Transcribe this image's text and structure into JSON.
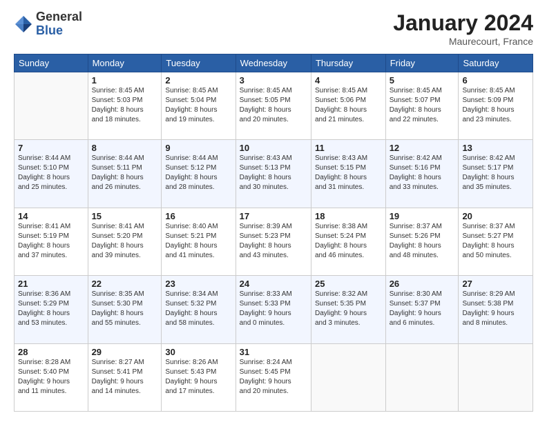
{
  "header": {
    "logo_general": "General",
    "logo_blue": "Blue",
    "month_title": "January 2024",
    "location": "Maurecourt, France"
  },
  "weekdays": [
    "Sunday",
    "Monday",
    "Tuesday",
    "Wednesday",
    "Thursday",
    "Friday",
    "Saturday"
  ],
  "weeks": [
    [
      {
        "day": "",
        "sunrise": "",
        "sunset": "",
        "daylight": ""
      },
      {
        "day": "1",
        "sunrise": "Sunrise: 8:45 AM",
        "sunset": "Sunset: 5:03 PM",
        "daylight": "Daylight: 8 hours and 18 minutes."
      },
      {
        "day": "2",
        "sunrise": "Sunrise: 8:45 AM",
        "sunset": "Sunset: 5:04 PM",
        "daylight": "Daylight: 8 hours and 19 minutes."
      },
      {
        "day": "3",
        "sunrise": "Sunrise: 8:45 AM",
        "sunset": "Sunset: 5:05 PM",
        "daylight": "Daylight: 8 hours and 20 minutes."
      },
      {
        "day": "4",
        "sunrise": "Sunrise: 8:45 AM",
        "sunset": "Sunset: 5:06 PM",
        "daylight": "Daylight: 8 hours and 21 minutes."
      },
      {
        "day": "5",
        "sunrise": "Sunrise: 8:45 AM",
        "sunset": "Sunset: 5:07 PM",
        "daylight": "Daylight: 8 hours and 22 minutes."
      },
      {
        "day": "6",
        "sunrise": "Sunrise: 8:45 AM",
        "sunset": "Sunset: 5:09 PM",
        "daylight": "Daylight: 8 hours and 23 minutes."
      }
    ],
    [
      {
        "day": "7",
        "sunrise": "Sunrise: 8:44 AM",
        "sunset": "Sunset: 5:10 PM",
        "daylight": "Daylight: 8 hours and 25 minutes."
      },
      {
        "day": "8",
        "sunrise": "Sunrise: 8:44 AM",
        "sunset": "Sunset: 5:11 PM",
        "daylight": "Daylight: 8 hours and 26 minutes."
      },
      {
        "day": "9",
        "sunrise": "Sunrise: 8:44 AM",
        "sunset": "Sunset: 5:12 PM",
        "daylight": "Daylight: 8 hours and 28 minutes."
      },
      {
        "day": "10",
        "sunrise": "Sunrise: 8:43 AM",
        "sunset": "Sunset: 5:13 PM",
        "daylight": "Daylight: 8 hours and 30 minutes."
      },
      {
        "day": "11",
        "sunrise": "Sunrise: 8:43 AM",
        "sunset": "Sunset: 5:15 PM",
        "daylight": "Daylight: 8 hours and 31 minutes."
      },
      {
        "day": "12",
        "sunrise": "Sunrise: 8:42 AM",
        "sunset": "Sunset: 5:16 PM",
        "daylight": "Daylight: 8 hours and 33 minutes."
      },
      {
        "day": "13",
        "sunrise": "Sunrise: 8:42 AM",
        "sunset": "Sunset: 5:17 PM",
        "daylight": "Daylight: 8 hours and 35 minutes."
      }
    ],
    [
      {
        "day": "14",
        "sunrise": "Sunrise: 8:41 AM",
        "sunset": "Sunset: 5:19 PM",
        "daylight": "Daylight: 8 hours and 37 minutes."
      },
      {
        "day": "15",
        "sunrise": "Sunrise: 8:41 AM",
        "sunset": "Sunset: 5:20 PM",
        "daylight": "Daylight: 8 hours and 39 minutes."
      },
      {
        "day": "16",
        "sunrise": "Sunrise: 8:40 AM",
        "sunset": "Sunset: 5:21 PM",
        "daylight": "Daylight: 8 hours and 41 minutes."
      },
      {
        "day": "17",
        "sunrise": "Sunrise: 8:39 AM",
        "sunset": "Sunset: 5:23 PM",
        "daylight": "Daylight: 8 hours and 43 minutes."
      },
      {
        "day": "18",
        "sunrise": "Sunrise: 8:38 AM",
        "sunset": "Sunset: 5:24 PM",
        "daylight": "Daylight: 8 hours and 46 minutes."
      },
      {
        "day": "19",
        "sunrise": "Sunrise: 8:37 AM",
        "sunset": "Sunset: 5:26 PM",
        "daylight": "Daylight: 8 hours and 48 minutes."
      },
      {
        "day": "20",
        "sunrise": "Sunrise: 8:37 AM",
        "sunset": "Sunset: 5:27 PM",
        "daylight": "Daylight: 8 hours and 50 minutes."
      }
    ],
    [
      {
        "day": "21",
        "sunrise": "Sunrise: 8:36 AM",
        "sunset": "Sunset: 5:29 PM",
        "daylight": "Daylight: 8 hours and 53 minutes."
      },
      {
        "day": "22",
        "sunrise": "Sunrise: 8:35 AM",
        "sunset": "Sunset: 5:30 PM",
        "daylight": "Daylight: 8 hours and 55 minutes."
      },
      {
        "day": "23",
        "sunrise": "Sunrise: 8:34 AM",
        "sunset": "Sunset: 5:32 PM",
        "daylight": "Daylight: 8 hours and 58 minutes."
      },
      {
        "day": "24",
        "sunrise": "Sunrise: 8:33 AM",
        "sunset": "Sunset: 5:33 PM",
        "daylight": "Daylight: 9 hours and 0 minutes."
      },
      {
        "day": "25",
        "sunrise": "Sunrise: 8:32 AM",
        "sunset": "Sunset: 5:35 PM",
        "daylight": "Daylight: 9 hours and 3 minutes."
      },
      {
        "day": "26",
        "sunrise": "Sunrise: 8:30 AM",
        "sunset": "Sunset: 5:37 PM",
        "daylight": "Daylight: 9 hours and 6 minutes."
      },
      {
        "day": "27",
        "sunrise": "Sunrise: 8:29 AM",
        "sunset": "Sunset: 5:38 PM",
        "daylight": "Daylight: 9 hours and 8 minutes."
      }
    ],
    [
      {
        "day": "28",
        "sunrise": "Sunrise: 8:28 AM",
        "sunset": "Sunset: 5:40 PM",
        "daylight": "Daylight: 9 hours and 11 minutes."
      },
      {
        "day": "29",
        "sunrise": "Sunrise: 8:27 AM",
        "sunset": "Sunset: 5:41 PM",
        "daylight": "Daylight: 9 hours and 14 minutes."
      },
      {
        "day": "30",
        "sunrise": "Sunrise: 8:26 AM",
        "sunset": "Sunset: 5:43 PM",
        "daylight": "Daylight: 9 hours and 17 minutes."
      },
      {
        "day": "31",
        "sunrise": "Sunrise: 8:24 AM",
        "sunset": "Sunset: 5:45 PM",
        "daylight": "Daylight: 9 hours and 20 minutes."
      },
      {
        "day": "",
        "sunrise": "",
        "sunset": "",
        "daylight": ""
      },
      {
        "day": "",
        "sunrise": "",
        "sunset": "",
        "daylight": ""
      },
      {
        "day": "",
        "sunrise": "",
        "sunset": "",
        "daylight": ""
      }
    ]
  ]
}
